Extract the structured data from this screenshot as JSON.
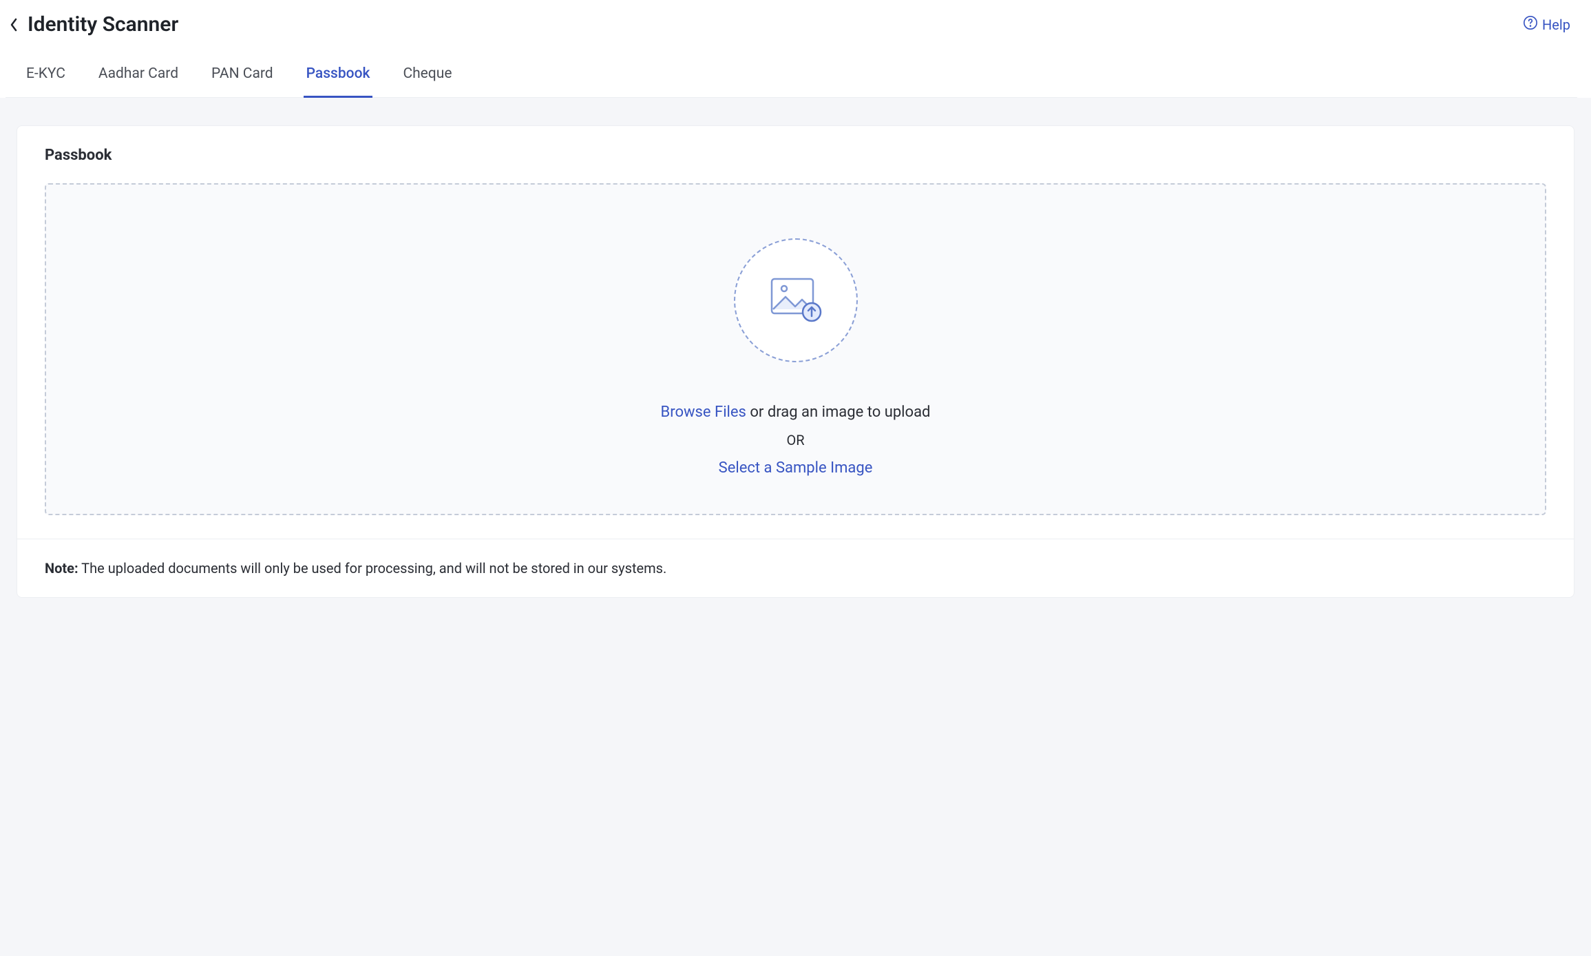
{
  "header": {
    "title": "Identity Scanner",
    "help_label": "Help"
  },
  "tabs": [
    {
      "label": "E-KYC",
      "active": false
    },
    {
      "label": "Aadhar Card",
      "active": false
    },
    {
      "label": "PAN Card",
      "active": false
    },
    {
      "label": "Passbook",
      "active": true
    },
    {
      "label": "Cheque",
      "active": false
    }
  ],
  "card": {
    "title": "Passbook"
  },
  "upload": {
    "browse_label": "Browse Files",
    "drag_text": " or drag an image to upload",
    "or_label": "OR",
    "sample_link": "Select a Sample Image"
  },
  "note": {
    "label": "Note:",
    "text": " The uploaded documents will only be used for processing, and will not be stored in our systems."
  }
}
